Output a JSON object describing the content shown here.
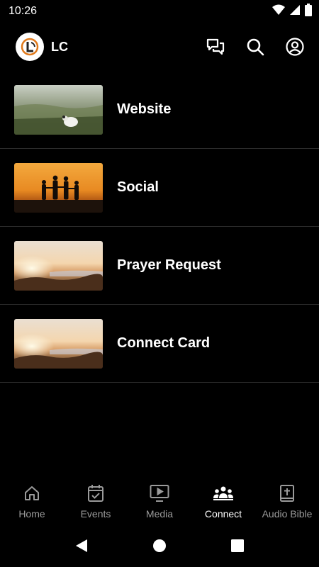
{
  "status_bar": {
    "time": "10:26"
  },
  "app_bar": {
    "title": "LC"
  },
  "list": [
    {
      "label": "Website",
      "thumb": "field-with-sheep"
    },
    {
      "label": "Social",
      "thumb": "family-silhouette-sunset"
    },
    {
      "label": "Prayer Request",
      "thumb": "sunrise-mountains"
    },
    {
      "label": "Connect Card",
      "thumb": "sunrise-mountains"
    }
  ],
  "bottom_nav": {
    "items": [
      {
        "label": "Home",
        "icon": "home-icon"
      },
      {
        "label": "Events",
        "icon": "calendar-check-icon"
      },
      {
        "label": "Media",
        "icon": "tv-play-icon"
      },
      {
        "label": "Connect",
        "icon": "group-icon",
        "active": true
      },
      {
        "label": "Audio Bible",
        "icon": "bible-icon"
      }
    ]
  },
  "colors": {
    "background": "#000000",
    "inactive": "#9a9a9a",
    "active": "#ffffff",
    "accent": "#e07a1c"
  }
}
